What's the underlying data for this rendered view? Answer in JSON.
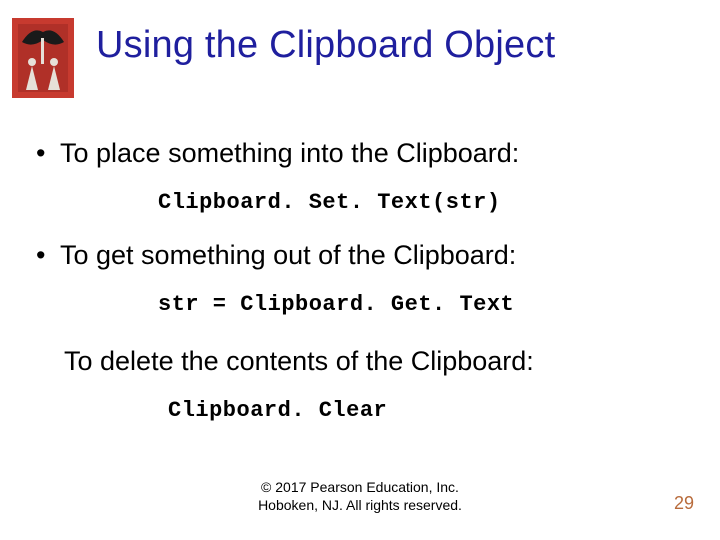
{
  "title": "Using the Clipboard Object",
  "bullets": [
    {
      "text": "To place something into the Clipboard:",
      "code": "Clipboard. Set. Text(str)"
    },
    {
      "text": "To get something out of the Clipboard:",
      "code": "str = Clipboard. Get. Text"
    }
  ],
  "line3": "To delete the contents of the Clipboard:",
  "code3": "Clipboard. Clear",
  "footer": {
    "line1": "© 2017 Pearson Education, Inc.",
    "line2": "Hoboken, NJ. All rights reserved."
  },
  "page_number": "29",
  "logo": {
    "name": "decorative-slide-logo"
  }
}
